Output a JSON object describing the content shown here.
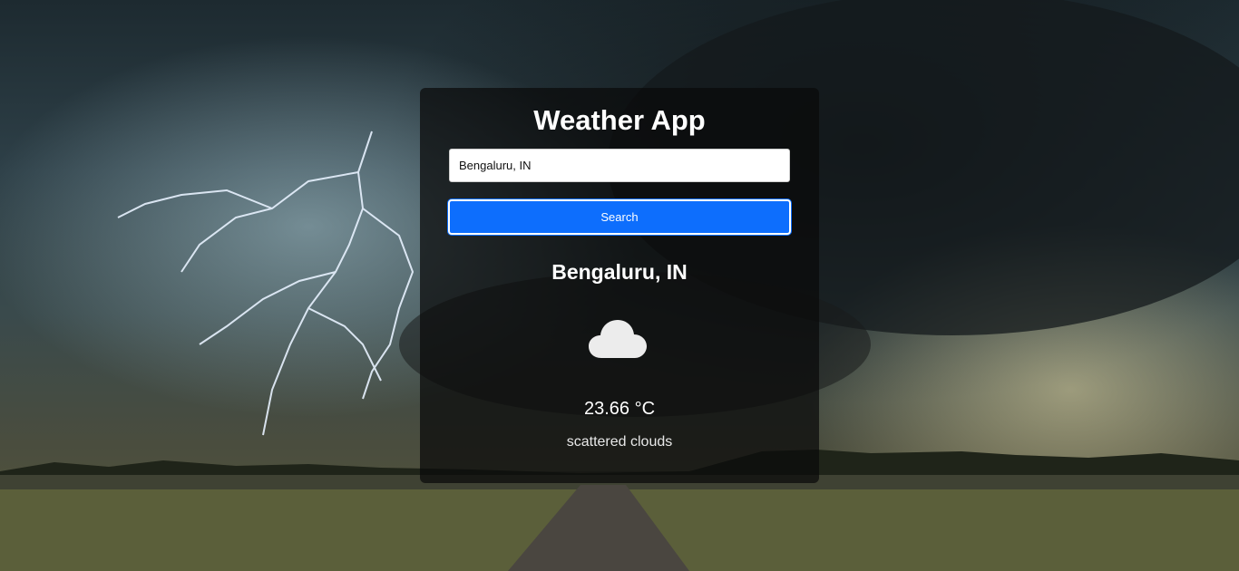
{
  "app": {
    "title": "Weather App"
  },
  "search": {
    "value": "Bengaluru, IN",
    "button_label": "Search"
  },
  "weather": {
    "location": "Bengaluru, IN",
    "icon": "cloud-icon",
    "temperature": "23.66 °C",
    "description": "scattered clouds"
  },
  "colors": {
    "accent": "#0d6efd",
    "card_background": "rgba(10,10,10,0.72)"
  }
}
